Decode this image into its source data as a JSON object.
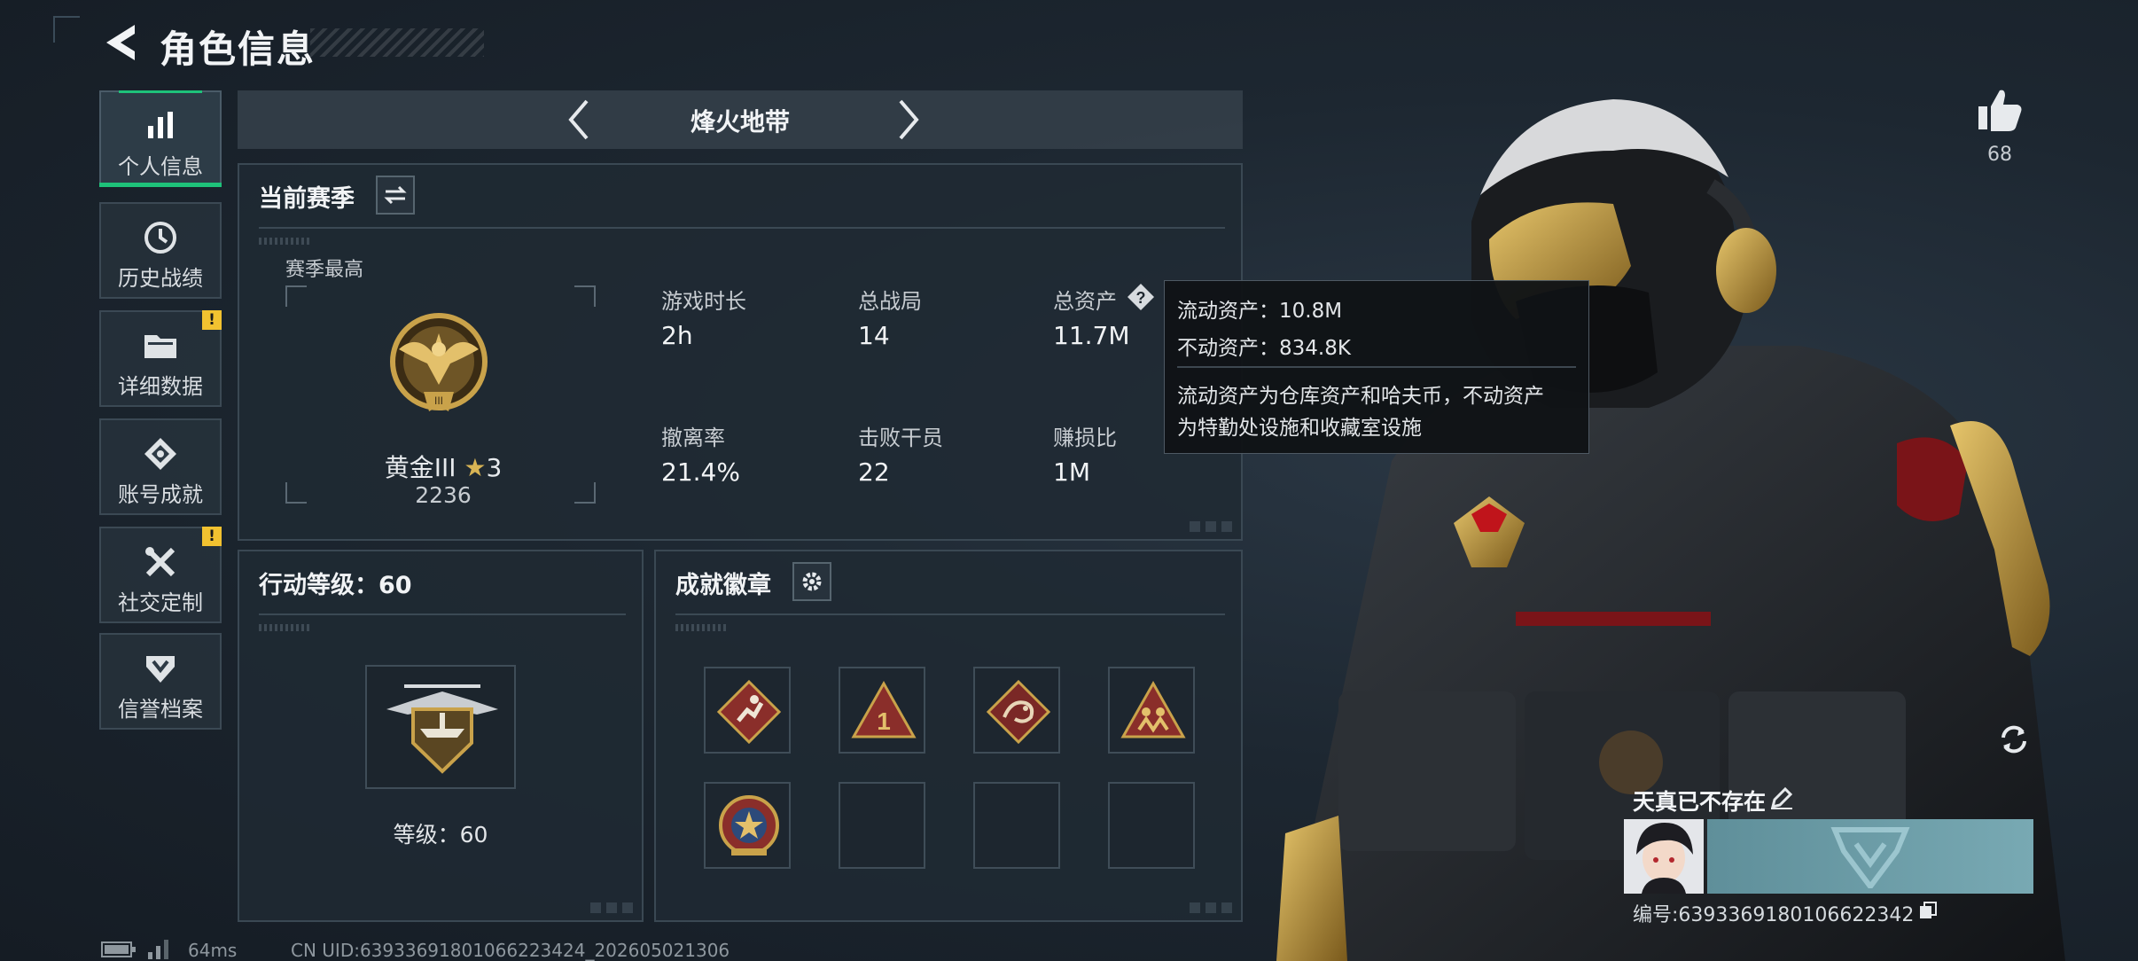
{
  "header": {
    "title": "角色信息"
  },
  "sidebar": {
    "items": [
      {
        "label": "个人信息",
        "icon": "bar-chart-icon",
        "active": true,
        "alert": false
      },
      {
        "label": "历史战绩",
        "icon": "history-icon",
        "active": false,
        "alert": false
      },
      {
        "label": "详细数据",
        "icon": "folder-icon",
        "active": false,
        "alert": true
      },
      {
        "label": "账号成就",
        "icon": "achievement-icon",
        "active": false,
        "alert": false
      },
      {
        "label": "社交定制",
        "icon": "tools-icon",
        "active": false,
        "alert": true
      },
      {
        "label": "信誉档案",
        "icon": "shield-icon",
        "active": false,
        "alert": false
      }
    ],
    "alert_mark": "!"
  },
  "mode_selector": {
    "name": "烽火地带"
  },
  "season": {
    "title": "当前赛季",
    "best_label": "赛季最高",
    "rank_name": "黄金III",
    "rank_stars": "3",
    "rank_score": "2236",
    "stats": [
      {
        "label": "游戏时长",
        "value": "2h"
      },
      {
        "label": "总战局",
        "value": "14"
      },
      {
        "label": "总资产",
        "value": "11.7M"
      },
      {
        "label": "撤离率",
        "value": "21.4%"
      },
      {
        "label": "击败干员",
        "value": "22"
      },
      {
        "label": "赚损比",
        "value": "1M"
      }
    ]
  },
  "tooltip": {
    "liquid": "流动资产：10.8M",
    "fixed": "不动资产：834.8K",
    "desc_line1": "流动资产为仓库资产和哈夫币，不动资产",
    "desc_line2": "为特勤处设施和收藏室设施"
  },
  "action_level": {
    "title": "行动等级：60",
    "level_text": "等级：60"
  },
  "badges": {
    "title": "成就徽章",
    "slots": [
      "runner-badge",
      "first-place-badge",
      "dragon-badge",
      "squad-badge",
      "star-emblem-badge",
      "",
      "",
      ""
    ]
  },
  "character": {
    "like_count": "68",
    "player_name": "天真已不存在",
    "player_id": "编号:6393369180106622342"
  },
  "footer": {
    "ping": "64ms",
    "uid": "CN UID:6393369180106622342​4_202605021306"
  },
  "colors": {
    "accent_green": "#1ec27a",
    "alert_yellow": "#f2c230",
    "gold": "#c9a24a"
  }
}
